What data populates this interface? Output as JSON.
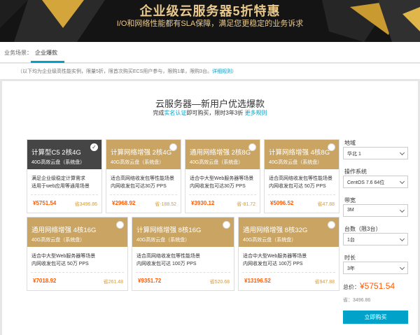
{
  "banner": {
    "title": "企业级云服务器5折特惠",
    "subtitle": "I/O和网络性能都有SLA保障，满足您更稳定的业务诉求"
  },
  "nav": {
    "label": "业务场景：",
    "active_tab": "企业爆款"
  },
  "notice": {
    "text": "（以下均为企业级高性能实例，限量5折，限首次购买ECS用户参与，限购1单，限购3台。",
    "link": "详细规则",
    "close": "）"
  },
  "section": {
    "title": "云服务器—新用户优选爆款",
    "sub_prefix": "完成",
    "sub_link": "实名认证",
    "sub_middle": "即可购买，限时3年3折",
    "sub_more": "更多规则"
  },
  "cards": [
    {
      "name": "计算型C5 2核4G",
      "disk": "40G高效云盘（系统盘）",
      "desc1": "满足企业级稳定计算需求",
      "desc2": "适用于web应用等通用场景",
      "price": "¥5751.54",
      "save": "省3496.86",
      "selected": true
    },
    {
      "name": "计算网络增强 2核4G",
      "disk": "40G高效云盘（系统盘）",
      "desc1": "适合高网络收发包等性能场景",
      "desc2": "内网收发包可达30万 PPS",
      "price": "¥2968.92",
      "save": "省-188.52",
      "selected": false
    },
    {
      "name": "通用网络增强 2核8G",
      "disk": "40G高效云盘（系统盘）",
      "desc1": "适合中大型Web服务器等场景",
      "desc2": "内网收发包可达30万 PPS",
      "price": "¥3930.12",
      "save": "省-81.72",
      "selected": false
    },
    {
      "name": "计算网络增强 4核8G",
      "disk": "40G高效云盘（系统盘）",
      "desc1": "适合高网络收发包等性能场景",
      "desc2": "内网收发包可达 50万 PPS",
      "price": "¥5096.52",
      "save": "省47.88",
      "selected": false
    },
    {
      "name": "通用网络增强 4核16G",
      "disk": "40G高效云盘（系统盘）",
      "desc1": "适合中大型Web服务器等场景",
      "desc2": "内网收发包可达 50万 PPS",
      "price": "¥7018.92",
      "save": "省261.48",
      "selected": false
    },
    {
      "name": "计算网络增强 8核16G",
      "disk": "40G高效云盘（系统盘）",
      "desc1": "适合高网络收发包等性能场景",
      "desc2": "内网收发包可达 100万 PPS",
      "price": "¥9351.72",
      "save": "省520.68",
      "selected": false
    },
    {
      "name": "通用网络增强 8核32G",
      "disk": "40G高效云盘（系统盘）",
      "desc1": "适合中大型Web服务器等场景",
      "desc2": "内网收发包可达 100万 PPS",
      "price": "¥13196.52",
      "save": "省947.88",
      "selected": false
    }
  ],
  "form": {
    "region_label": "地域",
    "region_value": "华北 1",
    "os_label": "操作系统",
    "os_value": "CentOS 7.6 64位",
    "bandwidth_label": "带宽",
    "bandwidth_value": "3M",
    "count_label": "台数（限3台）",
    "count_value": "1台",
    "duration_label": "时长",
    "duration_value": "3年",
    "total_label": "总价：",
    "total_value": "¥5751.54",
    "orig_value": "省：3496.86",
    "buy_label": "立即购买"
  },
  "colors": {
    "accent": "#00a2ca",
    "gold": "#c9a462",
    "dark_selected": "#454545",
    "price": "#ff5a00"
  }
}
